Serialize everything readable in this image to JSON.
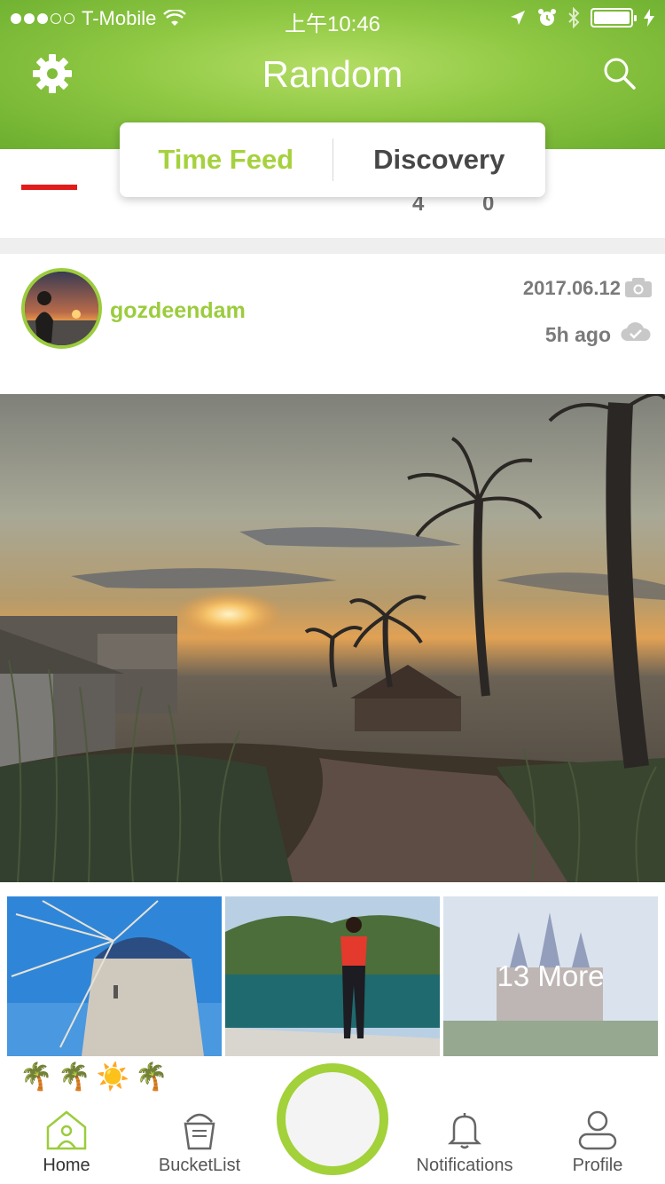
{
  "status_bar": {
    "carrier": "T-Mobile",
    "time": "上午10:46",
    "signal_bars_filled": 3,
    "signal_bars_total": 5
  },
  "header": {
    "title": "Random",
    "settings_icon": "gear-icon",
    "search_icon": "search-icon",
    "background_color": "#8fc843"
  },
  "segments": {
    "time_feed": "Time Feed",
    "discovery": "Discovery",
    "active": "time_feed",
    "active_color": "#a6d13e"
  },
  "counts": [
    "4",
    "0"
  ],
  "post": {
    "username": "gozdeendam",
    "date": "2017.06.12",
    "ago": "5h ago",
    "more_label": "13 More",
    "emojis": [
      "🌴",
      "🌴",
      "☀️",
      "🌴"
    ]
  },
  "tabbar": {
    "home": "Home",
    "bucketlist": "BucketList",
    "notifications": "Notifications",
    "profile": "Profile",
    "accent_color": "#a2d13a"
  }
}
